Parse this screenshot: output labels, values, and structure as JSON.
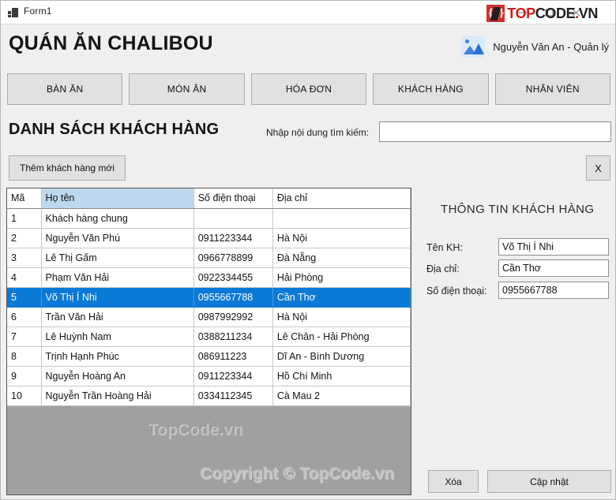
{
  "window": {
    "title": "Form1",
    "icon": "form-icon",
    "controls": {
      "minimize": "minimize-icon",
      "maximize": "maximize-icon",
      "close": "close-icon"
    }
  },
  "logo": {
    "mark_left": "{",
    "mark_right": "}",
    "text_top": "TOP",
    "text_code": "CODE",
    "text_dot": ".",
    "text_vn": "VN"
  },
  "header": {
    "brand": "QUÁN ĂN CHALIBOU",
    "user": "Nguyễn Văn An - Quản lý",
    "avatar": "user-photo-icon"
  },
  "nav": {
    "items": [
      {
        "label": "BÀN ĂN"
      },
      {
        "label": "MÓN ĂN"
      },
      {
        "label": "HÓA ĐƠN"
      },
      {
        "label": "KHÁCH HÀNG"
      },
      {
        "label": "NHÂN VIÊN"
      }
    ]
  },
  "section": {
    "title": "DANH SÁCH KHÁCH HÀNG",
    "search_label": "Nhập nội dung tìm kiếm:",
    "search_value": "",
    "search_placeholder": ""
  },
  "actions": {
    "add_label": "Thêm khách hàng mới",
    "close_label": "X"
  },
  "grid": {
    "columns": [
      {
        "key": "ma",
        "label": "Mã"
      },
      {
        "key": "hoten",
        "label": "Họ tên"
      },
      {
        "key": "sdt",
        "label": "Số điện thoại"
      },
      {
        "key": "diachi",
        "label": "Địa chỉ"
      }
    ],
    "selected_column_index": 1,
    "selected_row_index": 4,
    "rows": [
      {
        "ma": "1",
        "hoten": "Khách hàng chung",
        "sdt": "",
        "diachi": ""
      },
      {
        "ma": "2",
        "hoten": "Nguyễn Văn Phú",
        "sdt": "0911223344",
        "diachi": "Hà Nội"
      },
      {
        "ma": "3",
        "hoten": "Lê Thị Gấm",
        "sdt": "0966778899",
        "diachi": "Đà Nẵng"
      },
      {
        "ma": "4",
        "hoten": "Phạm Văn Hải",
        "sdt": "0922334455",
        "diachi": "Hải Phòng"
      },
      {
        "ma": "5",
        "hoten": "Võ Thị Í Nhi",
        "sdt": "0955667788",
        "diachi": "Cần Thơ"
      },
      {
        "ma": "6",
        "hoten": "Trần Văn Hải",
        "sdt": "0987992992",
        "diachi": "Hà Nội"
      },
      {
        "ma": "7",
        "hoten": "Lê Huỳnh Nam",
        "sdt": "0388211234",
        "diachi": "Lê Chân - Hải Phòng"
      },
      {
        "ma": "8",
        "hoten": "Trịnh Hạnh Phúc",
        "sdt": "086911223",
        "diachi": "Dĩ An - Bình Dương"
      },
      {
        "ma": "9",
        "hoten": "Nguyễn Hoàng An",
        "sdt": "0911223344",
        "diachi": "Hồ Chí Minh"
      },
      {
        "ma": "10",
        "hoten": "Nguyễn Trần Hoàng Hải",
        "sdt": "0334112345",
        "diachi": "Cà Mau 2"
      }
    ]
  },
  "detail": {
    "title": "THÔNG TIN KHÁCH HÀNG",
    "fields": [
      {
        "label": "Tên KH:",
        "value": "Võ Thị Í Nhi"
      },
      {
        "label": "Địa chỉ:",
        "value": "Cần Thơ"
      },
      {
        "label": "Số điện thoại:",
        "value": "0955667788"
      }
    ],
    "delete_label": "Xóa",
    "update_label": "Cập nhật"
  },
  "watermarks": {
    "grid": "TopCode.vn",
    "bottom": "Copyright © TopCode.vn"
  },
  "colors": {
    "accent_blue": "#0b7ad6",
    "header_highlight": "#bdd7ee",
    "brand_red": "#cf1c1c",
    "surface": "#efefef",
    "grid_empty": "#a0a0a0"
  }
}
